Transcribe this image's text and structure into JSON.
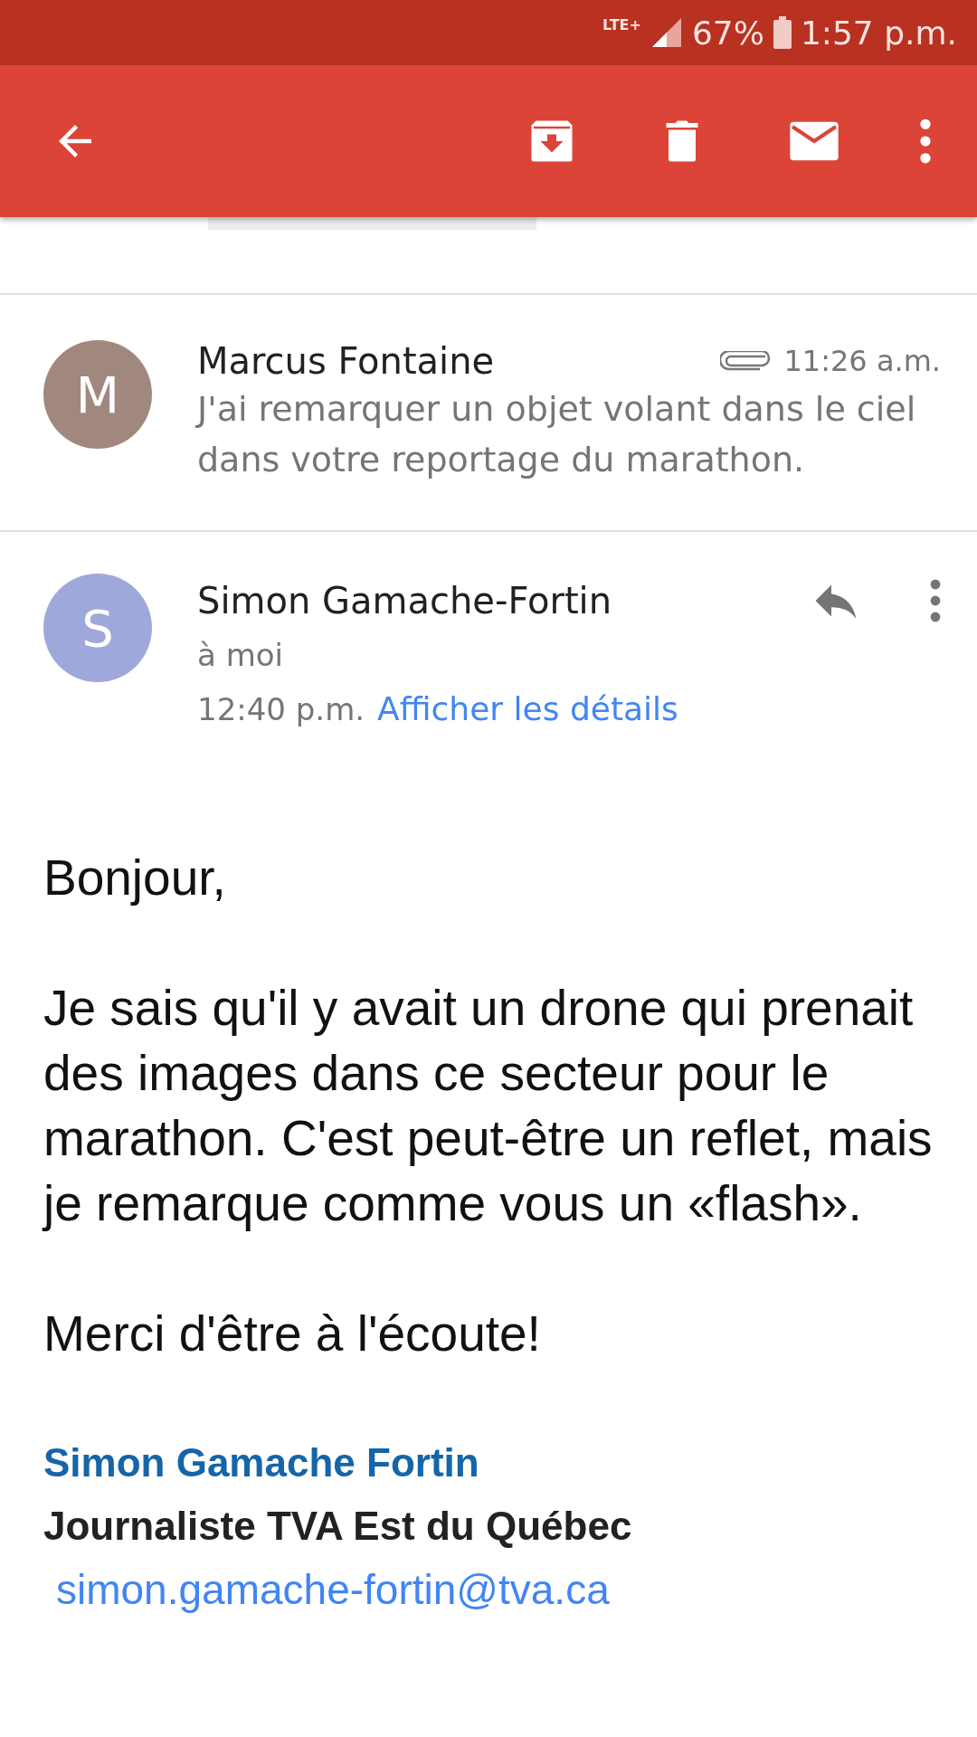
{
  "status_bar": {
    "network": "LTE+",
    "battery": "67%",
    "time": "1:57 p.m."
  },
  "messages": [
    {
      "initial": "M",
      "color": "#a1887f",
      "sender": "Marcus Fontaine",
      "has_attachment": true,
      "time": "11:26 a.m.",
      "snippet": "J'ai remarquer un objet volant dans le ciel dans votre reportage du marathon.",
      "expanded": false
    },
    {
      "initial": "S",
      "color": "#9fa8da",
      "sender": "Simon Gamache-Fortin",
      "has_attachment": false,
      "recipient": "à moi",
      "time": "12:40 p.m.",
      "details_link": "Afficher les détails",
      "expanded": true
    }
  ],
  "body": {
    "paragraphs": [
      "Bonjour,",
      "Je sais qu'il y avait un drone qui prenait des images dans ce secteur pour le marathon. C'est peut-être un reflet, mais je remarque comme vous un «flash».",
      "Merci d'être à l'écoute!"
    ],
    "signature": {
      "name": "Simon Gamache Fortin",
      "title": "Journaliste TVA Est du Québec",
      "email": "simon.gamache-fortin@tva.ca"
    }
  }
}
